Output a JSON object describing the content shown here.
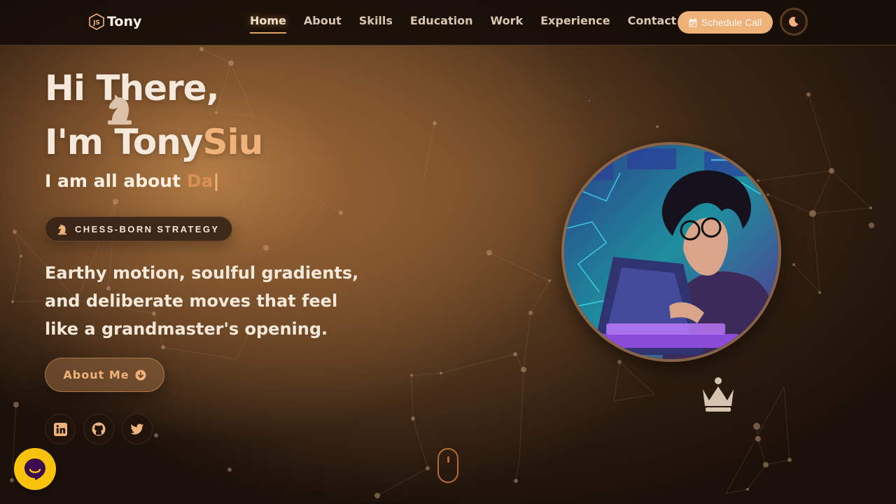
{
  "brand": {
    "name": "Tony"
  },
  "nav": {
    "links": [
      {
        "label": "Home",
        "active": true
      },
      {
        "label": "About"
      },
      {
        "label": "Skills"
      },
      {
        "label": "Education"
      },
      {
        "label": "Work"
      },
      {
        "label": "Experience"
      },
      {
        "label": "Contact"
      }
    ],
    "schedule_label": "Schedule Call",
    "schedule_icon": "calendar-icon",
    "theme_icon": "moon-icon"
  },
  "hero": {
    "greeting": "Hi There,",
    "name_prefix": "I'm Tony",
    "name_accent": "Siu",
    "subtitle_prefix": "I am all about ",
    "typed_text": "Da",
    "caret": "|",
    "chip_label": "CHESS-BORN STRATEGY",
    "chip_icon": "chess-knight-icon",
    "description": "Earthy motion, soulful gradients, and deliberate moves that feel like a grandmaster's opening.",
    "about_button": "About Me",
    "about_icon": "arrow-down-circle-icon",
    "socials": [
      {
        "name": "linkedin-icon"
      },
      {
        "name": "github-icon"
      },
      {
        "name": "twitter-icon"
      }
    ]
  },
  "decor": {
    "floating_piece_1": "chess-knight-icon",
    "floating_piece_2": "chess-queen-icon",
    "scroll_indicator": "mouse-scroll-icon",
    "chat": "chat-bubble-icon"
  },
  "colors": {
    "accent": "#efb27a",
    "button": "#eeb178",
    "chat": "#f8c20a",
    "nav_bg": "#160d08"
  }
}
